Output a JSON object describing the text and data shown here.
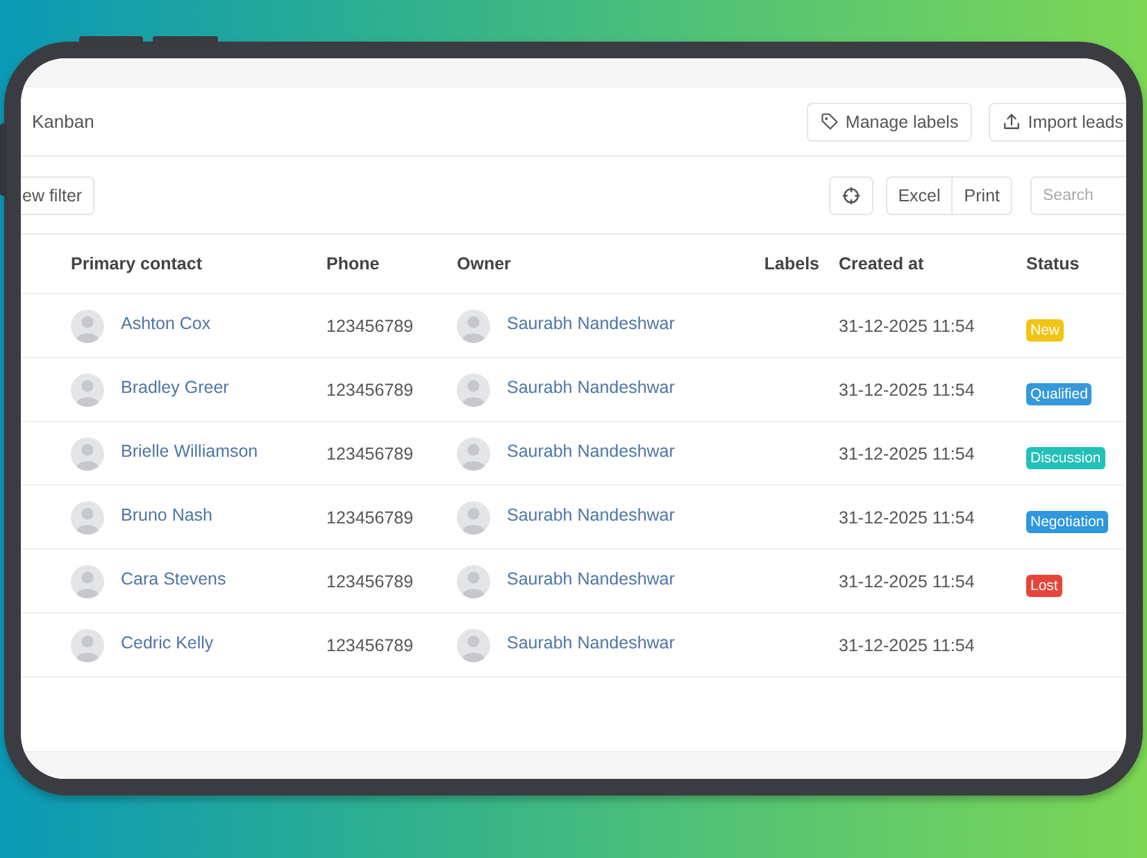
{
  "toolbar": {
    "view_tab": "Kanban",
    "manage_labels_button": "Manage labels",
    "import_button": "Import leads"
  },
  "filter_bar": {
    "new_filter_button": "ew filter",
    "export_buttons": [
      "Excel",
      "Print"
    ],
    "search": {
      "placeholder": "Search"
    }
  },
  "table": {
    "columns": [
      "Primary contact",
      "Phone",
      "Owner",
      "Labels",
      "Created at",
      "Status"
    ],
    "rows": [
      {
        "contact": "Ashton Cox",
        "phone": "123456789",
        "owner": "Saurabh Nandeshwar",
        "created_at": "31-12-2025 11:54",
        "status": {
          "label": "New",
          "color": "#f2c414"
        }
      },
      {
        "contact": "Bradley Greer",
        "phone": "123456789",
        "owner": "Saurabh Nandeshwar",
        "created_at": "31-12-2025 11:54",
        "status": {
          "label": "Qualified",
          "color": "#3598db"
        }
      },
      {
        "contact": "Brielle Williamson",
        "phone": "123456789",
        "owner": "Saurabh Nandeshwar",
        "created_at": "31-12-2025 11:54",
        "status": {
          "label": "Discussion",
          "color": "#22c1b8"
        }
      },
      {
        "contact": "Bruno Nash",
        "phone": "123456789",
        "owner": "Saurabh Nandeshwar",
        "created_at": "31-12-2025 11:54",
        "status": {
          "label": "Negotiation",
          "color": "#2e97de"
        }
      },
      {
        "contact": "Cara Stevens",
        "phone": "123456789",
        "owner": "Saurabh Nandeshwar",
        "created_at": "31-12-2025 11:54",
        "status": {
          "label": "Lost",
          "color": "#e6453a"
        }
      },
      {
        "contact": "Cedric Kelly",
        "phone": "123456789",
        "owner": "Saurabh Nandeshwar",
        "created_at": "31-12-2025 11:54"
      }
    ]
  }
}
